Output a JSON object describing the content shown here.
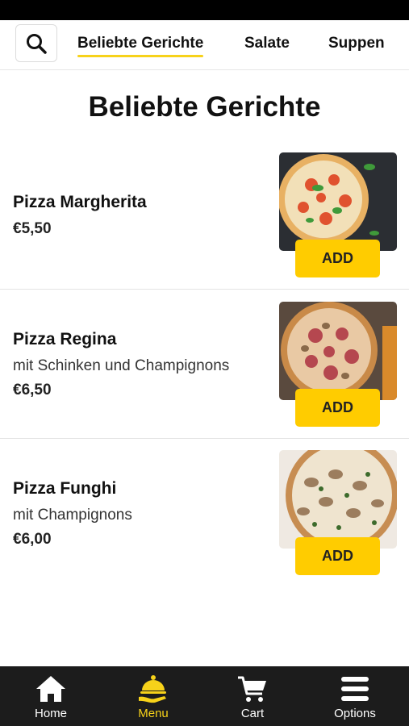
{
  "top_nav": {
    "tabs": [
      {
        "label": "Beliebte Gerichte",
        "active": true
      },
      {
        "label": "Salate",
        "active": false
      },
      {
        "label": "Suppen",
        "active": false
      }
    ]
  },
  "page_title": "Beliebte Gerichte",
  "items": [
    {
      "name": "Pizza Margherita",
      "description": "",
      "price": "€5,50",
      "add_label": "ADD"
    },
    {
      "name": "Pizza Regina",
      "description": "mit Schinken und Champignons",
      "price": "€6,50",
      "add_label": "ADD"
    },
    {
      "name": "Pizza Funghi",
      "description": "mit Champignons",
      "price": "€6,00",
      "add_label": "ADD"
    }
  ],
  "bottom_nav": [
    {
      "label": "Home",
      "icon": "home-icon",
      "active": false
    },
    {
      "label": "Menu",
      "icon": "menu-cloche-icon",
      "active": true
    },
    {
      "label": "Cart",
      "icon": "cart-icon",
      "active": false
    },
    {
      "label": "Options",
      "icon": "options-icon",
      "active": false
    }
  ],
  "colors": {
    "accent": "#ffcc00",
    "nav_bg": "#1c1c1c",
    "active_label": "#f7d21a"
  }
}
